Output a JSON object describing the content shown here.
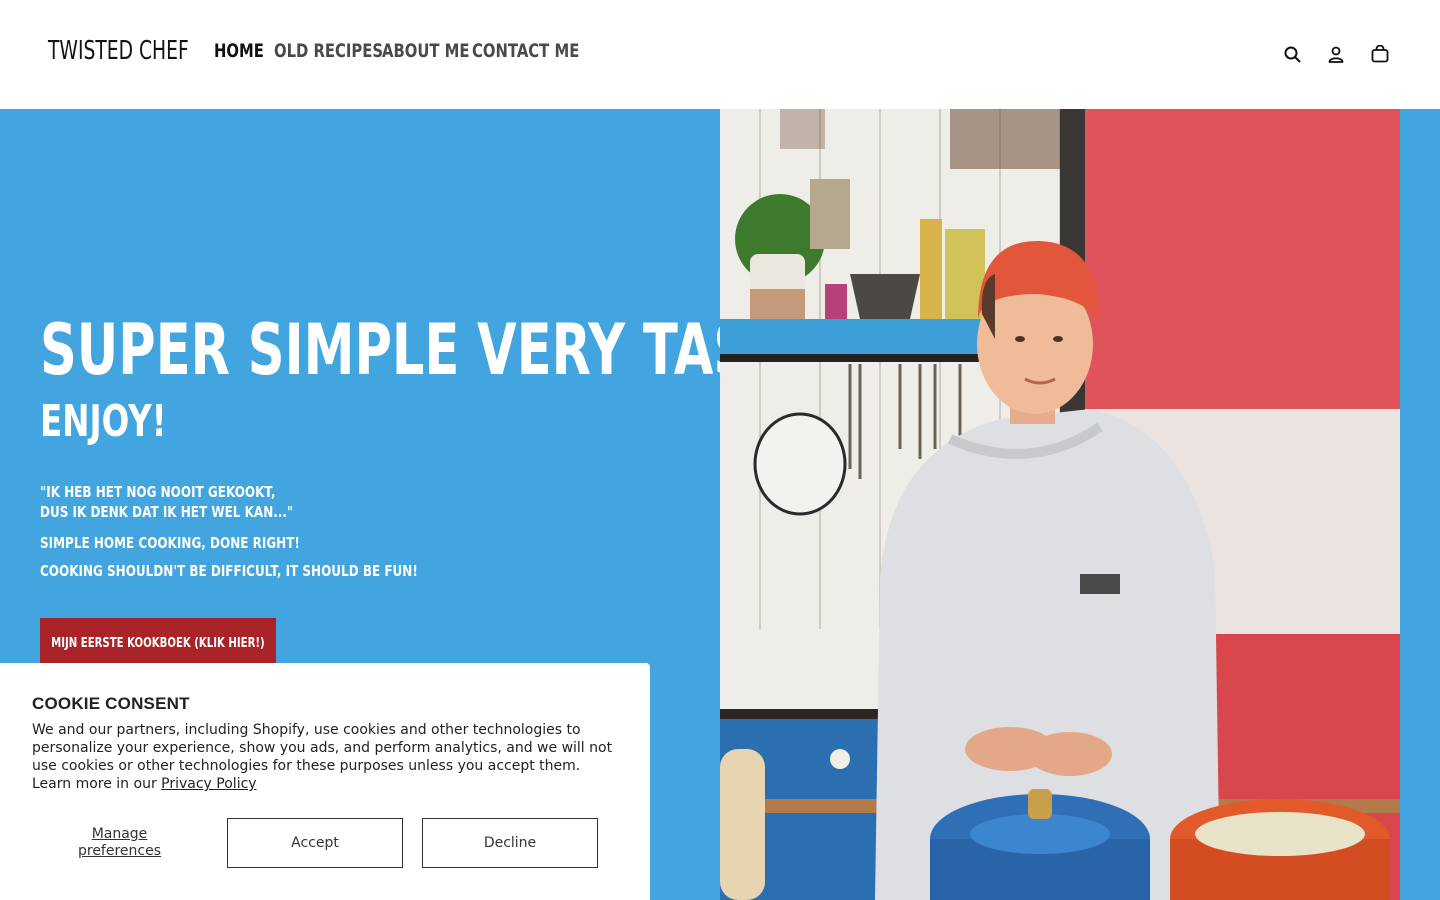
{
  "header": {
    "logo": "TWISTED CHEF",
    "nav": [
      {
        "label": "HOME",
        "active": true
      },
      {
        "label": "OLD RECIPES",
        "active": false
      },
      {
        "label": "ABOUT ME",
        "active": false
      },
      {
        "label": "CONTACT ME",
        "active": false
      }
    ],
    "icons": [
      "search-icon",
      "account-icon",
      "cart-icon"
    ]
  },
  "hero": {
    "headline": "SUPER SIMPLE VERY TASTY",
    "subheadline": "ENJOY!",
    "quote_line1": "\"IK HEB HET NOG NOOIT GEKOOKT,",
    "quote_line2": "DUS IK DENK DAT IK HET WEL KAN...\"",
    "tagline1": "SIMPLE HOME COOKING, DONE RIGHT!",
    "tagline2": "COOKING SHOULDN'T BE DIFFICULT, IT SHOULD BE FUN!",
    "cta_label": "MIJN EERSTE KOOKBOEK (KLIK HIER!)",
    "background_color": "#42a5df",
    "cta_color": "#a92329"
  },
  "cookie": {
    "title": "COOKIE CONSENT",
    "body": "We and our partners, including Shopify, use cookies and other technologies to personalize your experience, show you ads, and perform analytics, and we will not use cookies or other technologies for these purposes unless you accept them. Learn more in our ",
    "privacy_link": "Privacy Policy",
    "manage_line1": "Manage",
    "manage_line2": "preferences",
    "accept": "Accept",
    "decline": "Decline"
  }
}
